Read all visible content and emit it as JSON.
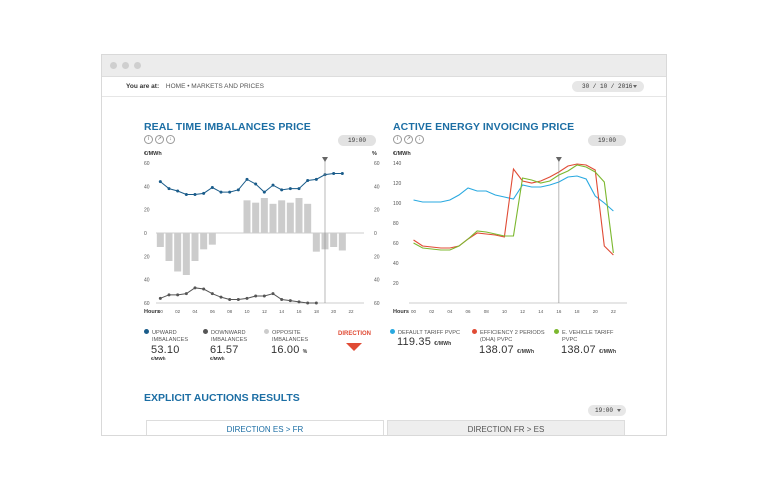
{
  "breadcrumb": {
    "label": "You are at:",
    "path": "HOME • MARKETS AND PRICES"
  },
  "date": "30 / 10 / 2016",
  "left_panel": {
    "title": "REAL TIME IMBALANCES PRICE",
    "time": "19:00",
    "left_unit": "€/MWh",
    "right_unit": "%",
    "hours_label": "Hours",
    "legend": [
      {
        "label_line1": "UPWARD",
        "label_line2": "IMBALANCES",
        "value": "53.10",
        "unit": "€/MWh",
        "color": "#1a5c8a"
      },
      {
        "label_line1": "DOWNWARD",
        "label_line2": "IMBALANCES",
        "value": "61.57",
        "unit": "€/MWh",
        "color": "#555555"
      },
      {
        "label_line1": "OPPOSITE",
        "label_line2": "IMBALANCES",
        "value": "16.00",
        "unit": "%",
        "color": "#cccccc"
      }
    ],
    "direction_label": "DIRECTION"
  },
  "right_panel": {
    "title": "ACTIVE ENERGY INVOICING PRICE",
    "time": "19:00",
    "unit": "€/MWh",
    "hours_label": "Hours",
    "legend": [
      {
        "label_line1": "DEFAULT TARIFF PVPC",
        "label_line2": "",
        "value": "119.35",
        "unit": "€/MWh",
        "color": "#29a9e0"
      },
      {
        "label_line1": "EFFICIENCY 2 PERIODS",
        "label_line2": "(DHA) PVPC",
        "value": "138.07",
        "unit": "€/MWh",
        "color": "#e04b35"
      },
      {
        "label_line1": "E. VEHICLE TARIFF",
        "label_line2": "PVPC",
        "value": "138.07",
        "unit": "€/MWh",
        "color": "#7cb82f"
      }
    ]
  },
  "auctions": {
    "title": "EXPLICIT AUCTIONS RESULTS",
    "time": "19:00",
    "tabs": [
      "DIRECTION ES > FR",
      "DIRECTION FR > ES"
    ]
  },
  "chart_data": [
    {
      "type": "bar+line",
      "title": "REAL TIME IMBALANCES PRICE",
      "x": [
        0,
        1,
        2,
        3,
        4,
        5,
        6,
        7,
        8,
        9,
        10,
        11,
        12,
        13,
        14,
        15,
        16,
        17,
        18,
        19,
        20,
        21,
        22,
        23
      ],
      "x_ticks": [
        "00",
        "02",
        "04",
        "06",
        "08",
        "10",
        "12",
        "14",
        "16",
        "18",
        "20",
        "22"
      ],
      "y_ticks_left": [
        "60",
        "40",
        "20",
        "0",
        "20",
        "40",
        "60"
      ],
      "y_ticks_right": [
        "60",
        "40",
        "20",
        "0",
        "20",
        "40",
        "60"
      ],
      "ylim": [
        -60,
        60
      ],
      "series": [
        {
          "name": "UPWARD IMBALANCES",
          "kind": "line",
          "color": "#1a5c8a",
          "values": [
            44,
            38,
            36,
            33,
            33,
            34,
            39,
            35,
            35,
            37,
            46,
            42,
            35,
            41,
            37,
            38,
            38,
            45,
            46,
            50,
            51,
            51
          ]
        },
        {
          "name": "DOWNWARD IMBALANCES",
          "kind": "line",
          "color": "#555555",
          "values": [
            -56,
            -53,
            -53,
            -52,
            -47,
            -48,
            -52,
            -55,
            -57,
            -57,
            -56,
            -54,
            -54,
            -52,
            -57,
            -58,
            -59,
            -60,
            -60
          ]
        },
        {
          "name": "OPPOSITE IMBALANCES",
          "kind": "bar",
          "color": "#cccccc",
          "values": [
            -12,
            -24,
            -33,
            -36,
            -24,
            -14,
            -10,
            0,
            0,
            0,
            28,
            26,
            30,
            25,
            28,
            26,
            30,
            25,
            -16,
            -14,
            -12,
            -15
          ]
        }
      ],
      "cursor_x": 19
    },
    {
      "type": "line",
      "title": "ACTIVE ENERGY INVOICING PRICE",
      "x_ticks": [
        "00",
        "02",
        "04",
        "06",
        "08",
        "10",
        "12",
        "14",
        "16",
        "18",
        "20",
        "22"
      ],
      "y_ticks": [
        "140",
        "120",
        "100",
        "80",
        "60",
        "40",
        "20"
      ],
      "ylim": [
        0,
        140
      ],
      "series": [
        {
          "name": "DEFAULT TARIFF PVPC",
          "color": "#29a9e0",
          "values": [
            103,
            101,
            101,
            101,
            103,
            108,
            115,
            112,
            112,
            108,
            106,
            104,
            118,
            116,
            116,
            118,
            121,
            126,
            127,
            124,
            107,
            100,
            92
          ]
        },
        {
          "name": "EFFICIENCY 2 PERIODS (DHA) PVPC",
          "color": "#e04b35",
          "values": [
            63,
            57,
            56,
            55,
            55,
            57,
            64,
            70,
            69,
            68,
            66,
            134,
            122,
            120,
            122,
            126,
            131,
            137,
            139,
            138,
            133,
            57,
            48
          ]
        },
        {
          "name": "E. VEHICLE TARIFF PVPC",
          "color": "#7cb82f",
          "values": [
            60,
            55,
            54,
            53,
            53,
            57,
            64,
            72,
            71,
            69,
            67,
            67,
            125,
            123,
            120,
            122,
            128,
            132,
            138,
            136,
            131,
            121,
            50
          ]
        }
      ],
      "cursor_x": 16
    }
  ]
}
